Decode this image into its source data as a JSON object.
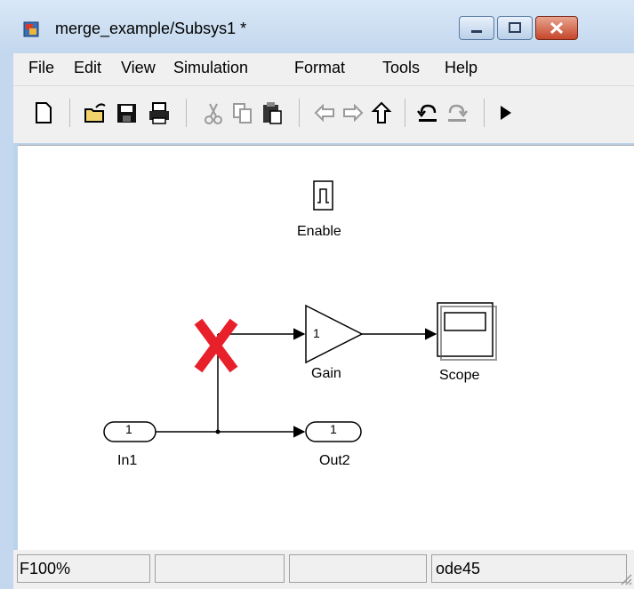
{
  "window": {
    "title": "merge_example/Subsys1 *"
  },
  "menu": [
    "File",
    "Edit",
    "View",
    "Simulation",
    "Format",
    "Tools",
    "Help"
  ],
  "toolbar_icons": [
    "new-icon",
    "open-icon",
    "save-icon",
    "print-icon",
    "cut-icon",
    "copy-icon",
    "paste-icon",
    "back-icon",
    "forward-icon",
    "up-icon",
    "undo-icon",
    "redo-icon",
    "play-icon"
  ],
  "blocks": {
    "enable": "Enable",
    "gain": "Gain",
    "gain_value": "1",
    "scope": "Scope",
    "in1": "In1",
    "in1_port": "1",
    "out2": "Out2",
    "out2_port": "1"
  },
  "status": {
    "cell1": "F",
    "zoom": "100%",
    "solver": "ode45"
  },
  "colors": {
    "error_mark": "#e8202a",
    "close_button": "#c6462b"
  }
}
